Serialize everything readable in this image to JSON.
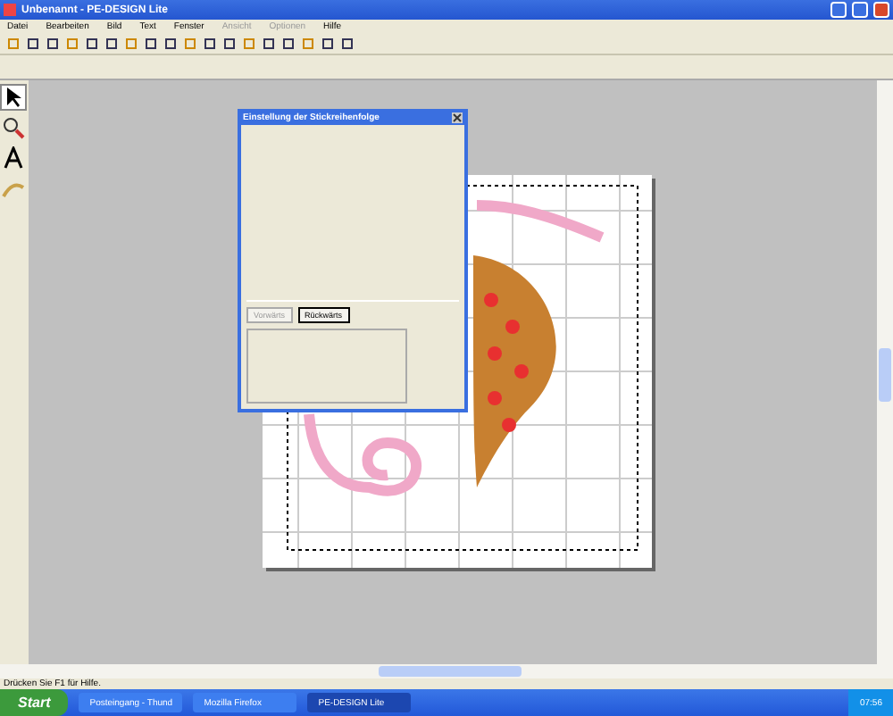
{
  "window": {
    "title": "Unbenannt - PE-DESIGN Lite"
  },
  "menu": [
    {
      "label": "Datei",
      "disabled": false
    },
    {
      "label": "Bearbeiten",
      "disabled": false
    },
    {
      "label": "Bild",
      "disabled": false
    },
    {
      "label": "Text",
      "disabled": false
    },
    {
      "label": "Fenster",
      "disabled": false
    },
    {
      "label": "Ansicht",
      "disabled": true
    },
    {
      "label": "Optionen",
      "disabled": true
    },
    {
      "label": "Hilfe",
      "disabled": false
    }
  ],
  "tools": [
    {
      "kind": "arrow",
      "selected": true
    },
    {
      "kind": "zoom",
      "selected": false
    },
    {
      "kind": "text",
      "selected": false
    },
    {
      "kind": "stitch",
      "selected": false
    }
  ],
  "dialog": {
    "title": "Einstellung der Stickreihenfolge",
    "buttons": [
      {
        "label": "Vorwärts",
        "disabled": true
      },
      {
        "label": "Rückwärts",
        "disabled": false
      }
    ]
  },
  "status_bar": "Drücken Sie F1 für Hilfe.",
  "taskbar": {
    "start": "Start",
    "tasks": [
      {
        "label": "Posteingang - Thund",
        "selected": false
      },
      {
        "label": "Mozilla Firefox",
        "selected": false
      },
      {
        "label": "PE-DESIGN Lite",
        "selected": true
      }
    ],
    "clock": "07:56"
  }
}
